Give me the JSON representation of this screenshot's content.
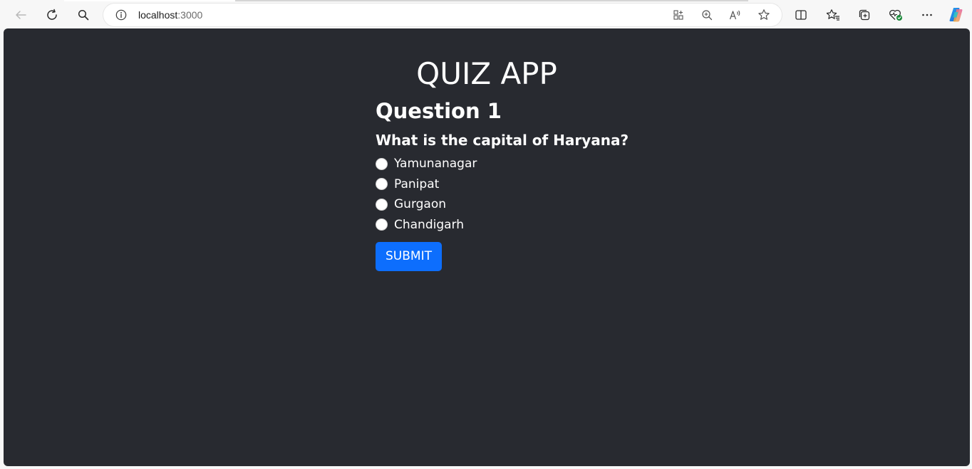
{
  "browser": {
    "url_host": "localhost",
    "url_port": ":3000"
  },
  "app": {
    "title": "QUIZ APP",
    "question_number": "Question 1",
    "question_text": "What is the capital of Haryana?",
    "options": [
      "Yamunanagar",
      "Panipat",
      "Gurgaon",
      "Chandigarh"
    ],
    "submit_label": "SUBMIT"
  },
  "colors": {
    "page_background": "#282a30",
    "submit_button": "#0d6efd",
    "text": "#ffffff"
  },
  "icons": {
    "back": "arrow-left-icon",
    "refresh": "refresh-icon",
    "search": "search-icon",
    "site_info": "info-icon",
    "app_available": "app-grid-icon",
    "zoom": "zoom-in-icon",
    "read_aloud": "read-aloud-icon",
    "favorite": "star-icon",
    "split_screen": "split-screen-icon",
    "favorites": "favorites-icon",
    "collections": "collections-icon",
    "browser_essentials": "heart-pulse-icon",
    "more": "more-icon",
    "copilot": "copilot-icon"
  }
}
